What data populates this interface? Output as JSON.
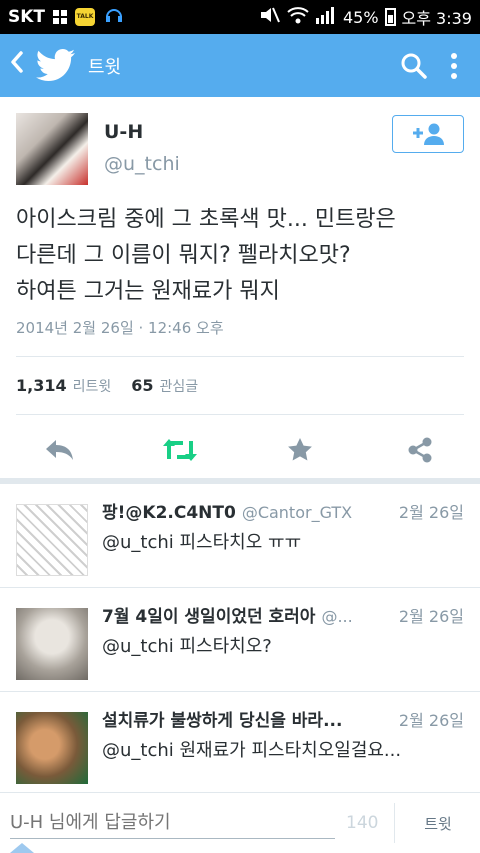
{
  "status_bar": {
    "carrier": "SKT",
    "talk_label": "TALK",
    "battery": "45%",
    "time": "오후 3:39"
  },
  "header": {
    "title": "트윗"
  },
  "tweet": {
    "author_name": "U-H",
    "author_handle": "@u_tchi",
    "text_line1": "아이스크림 중에 그 초록색 맛... 민트랑은",
    "text_line2": "다른데 그 이름이 뭐지? 펠라치오맛?",
    "text_line3": "하여튼 그거는 원재료가 뭐지",
    "timestamp": "2014년 2월 26일 · 12:46 오후",
    "retweet_count": "1,314",
    "retweet_label": "리트윗",
    "favorite_count": "65",
    "favorite_label": "관심글"
  },
  "replies": [
    {
      "name": "팡!@K2.C4NT0",
      "handle": "@Cantor_GTX",
      "date": "2월 26일",
      "text": "@u_tchi 피스타치오 ㅠㅠ"
    },
    {
      "name": "7월 4일이 생일이었던 호러아",
      "handle": "@...",
      "date": "2월 26일",
      "text": "@u_tchi 피스타치오?"
    },
    {
      "name": "설치류가 불쌍하게 당신을 바라...",
      "handle": "",
      "date": "2월 26일",
      "text": "@u_tchi 원재료가 피스타치오일걸요..."
    }
  ],
  "compose": {
    "placeholder": "U-H 님에게 답글하기",
    "char_count": "140",
    "send_label": "트윗"
  },
  "colors": {
    "brand": "#55acee",
    "retweet_green": "#19cf86",
    "text": "#292f33",
    "muted": "#8899a6"
  }
}
